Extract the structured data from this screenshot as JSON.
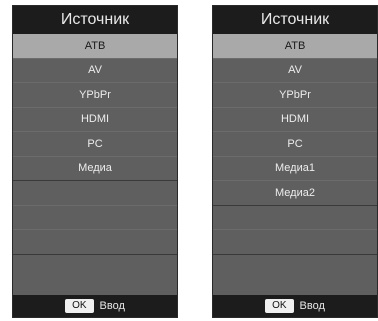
{
  "left_menu": {
    "title": "Источник",
    "items": [
      {
        "label": "ATB",
        "selected": true
      },
      {
        "label": "AV"
      },
      {
        "label": "YPbPr"
      },
      {
        "label": "HDMI"
      },
      {
        "label": "PC"
      },
      {
        "label": "Медиа"
      },
      {
        "label": ""
      },
      {
        "label": ""
      },
      {
        "label": ""
      },
      {
        "label": ""
      }
    ],
    "footer": {
      "ok_key": "OK",
      "action": "Ввод"
    }
  },
  "right_menu": {
    "title": "Источник",
    "items": [
      {
        "label": "ATB",
        "selected": true
      },
      {
        "label": "AV"
      },
      {
        "label": "YPbPr"
      },
      {
        "label": "HDMI"
      },
      {
        "label": "PC"
      },
      {
        "label": "Медиа1"
      },
      {
        "label": "Медиа2"
      },
      {
        "label": ""
      },
      {
        "label": ""
      },
      {
        "label": ""
      }
    ],
    "footer": {
      "ok_key": "OK",
      "action": "Ввод"
    }
  },
  "colors": {
    "selected_bg": "#a9a9a9",
    "panel_bg": "#5f5f5f",
    "header_bg": "#1c1c1c"
  }
}
